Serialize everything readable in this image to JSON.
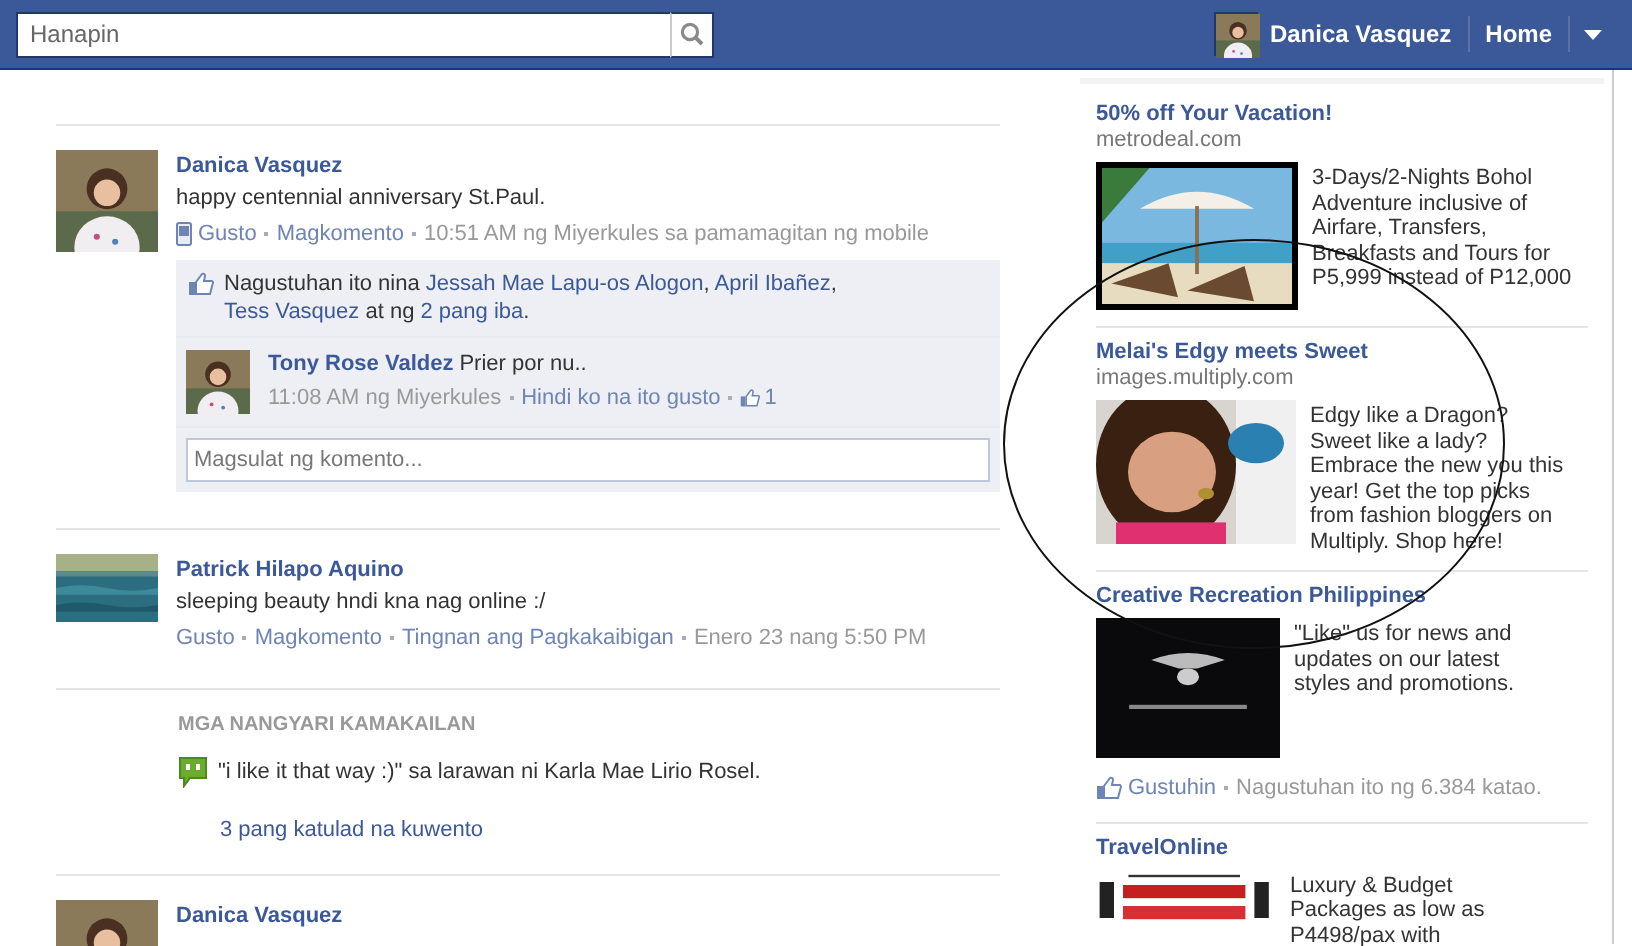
{
  "header": {
    "search": {
      "placeholder": "Hanapin"
    },
    "user_name": "Danica Vasquez",
    "nav": [
      "Home"
    ]
  },
  "feed": [
    {
      "kind": "post",
      "author": "Danica Vasquez",
      "text": "happy centennial anniversary St.Paul.",
      "via_mobile": true,
      "meta": [
        {
          "kind": "link",
          "text": "Gusto"
        },
        {
          "kind": "link",
          "text": "Magkomento"
        },
        {
          "kind": "time",
          "text": "10:51 AM ng Miyerkules sa pamamagitan ng mobile"
        }
      ],
      "likes": [
        {
          "text": "Nagustuhan ito nina ",
          "link": false
        },
        {
          "text": "Jessah Mae Lapu-os Alogon",
          "link": true
        },
        {
          "text": ", ",
          "link": false
        },
        {
          "text": "April Ibañez",
          "link": true
        },
        {
          "text": ", ",
          "link": false
        },
        {
          "text": "Tess Vasquez",
          "link": true
        },
        {
          "text": " at ng ",
          "link": false
        },
        {
          "text": "2 pang iba",
          "link": true
        },
        {
          "text": ".",
          "link": false
        }
      ],
      "comments": [
        {
          "author": "Tony Rose Valdez",
          "text": "Prier por nu..",
          "time": "11:08 AM ng Miyerkules",
          "action": "Hindi ko na ito gusto",
          "like_count": "1"
        }
      ],
      "comment_box": {
        "placeholder": "Magsulat ng komento..."
      }
    },
    {
      "kind": "post",
      "author": "Patrick Hilapo Aquino",
      "text": "sleeping beauty hndi kna nag online :/",
      "via_mobile": false,
      "meta": [
        {
          "kind": "link",
          "text": "Gusto"
        },
        {
          "kind": "link",
          "text": "Magkomento"
        },
        {
          "kind": "link",
          "text": "Tingnan ang Pagkakaibigan"
        },
        {
          "kind": "time",
          "text": "Enero 23 nang 5:50 PM"
        }
      ]
    },
    {
      "kind": "recent",
      "title": "MGA NANGYARI KAMAKAILAN",
      "item": "\"i like it that way :)\" sa larawan ni Karla Mae Lirio Rosel.",
      "more": "3 pang katulad na kuwento"
    },
    {
      "kind": "post",
      "author": "Danica Vasquez"
    }
  ],
  "ads": [
    {
      "title": "50% off Your Vacation!",
      "domain": "metrodeal.com",
      "body": "3-Days/2-Nights Bohol Adventure inclusive of Airfare, Transfers, Breakfasts and Tours for P5,999 instead of P12,000"
    },
    {
      "title": "Melai's Edgy meets Sweet",
      "domain": "images.multiply.com",
      "body": "Edgy like a Dragon? Sweet like a lady? Embrace the new you this year! Get the top picks from fashion bloggers on Multiply. Shop here!"
    },
    {
      "title": "Creative Recreation Philippines",
      "body": "\"Like\" us for news and updates on our latest styles and promotions.",
      "like": {
        "action": "Gustuhin",
        "count_text": "Nagustuhan ito ng 6.384 katao."
      }
    },
    {
      "title": "TravelOnline",
      "body": "Luxury & Budget Packages as low as P4498/pax with"
    }
  ],
  "annotation": {
    "kind": "ellipse"
  }
}
